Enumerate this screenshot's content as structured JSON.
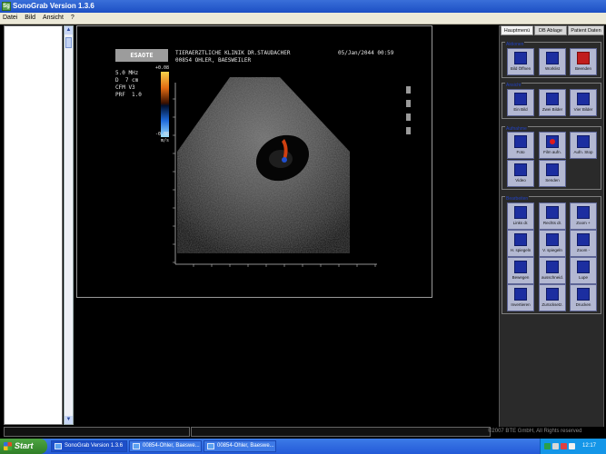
{
  "window": {
    "title": "SonoGrab Version 1.3.6",
    "app_icon": "Sg"
  },
  "menu": [
    "Datei",
    "Bild",
    "Ansicht",
    "?"
  ],
  "scrollbar": {
    "up": "▲",
    "down": "▼"
  },
  "ultrasound": {
    "brand": "ESAOTE",
    "header_line1": "TIERAERZTLICHE KLINIK DR.STAUDACHER",
    "header_line2": "00854 OHLER, BAESWEILER",
    "datetime": "05/Jan/2044 00:59",
    "params": [
      "5.0 MHz",
      "D  7 cm",
      "CFM V3",
      "PRF  1.0"
    ],
    "scale_top": "+0.08",
    "scale_bottom": "-0.08",
    "scale_unit": "m/s"
  },
  "panel": {
    "tabs": [
      "Hauptmenü",
      "DB Ablage",
      "Patient Daten"
    ],
    "groups": [
      {
        "title": "Aktionen",
        "buttons": [
          {
            "label": "Bild Öffnen",
            "icon": "folder-open-icon",
            "style": "blue"
          },
          {
            "label": "Worklist",
            "icon": "worklist-icon",
            "style": "blue"
          },
          {
            "label": "Beenden",
            "icon": "power-icon",
            "style": "red"
          }
        ]
      },
      {
        "title": "Ansicht",
        "buttons": [
          {
            "label": "Ein Bild",
            "icon": "single-view-icon",
            "style": "blue"
          },
          {
            "label": "Zwei Bilder",
            "icon": "two-view-icon",
            "style": "blue"
          },
          {
            "label": "Vier Bilder",
            "icon": "four-view-icon",
            "style": "blue"
          }
        ]
      },
      {
        "title": "Aufnahme",
        "buttons": [
          {
            "label": "Foto",
            "icon": "camera-icon",
            "style": "blue"
          },
          {
            "label": "Film aufn.",
            "icon": "record-icon",
            "style": "blue"
          },
          {
            "label": "Aufn. Stop",
            "icon": "stop-icon",
            "style": "blue"
          },
          {
            "label": "Video",
            "icon": "video-icon",
            "style": "blue"
          },
          {
            "label": "Senden",
            "icon": "send-icon",
            "style": "blue"
          }
        ]
      },
      {
        "title": "Bearbeiten",
        "buttons": [
          {
            "label": "Links dr.",
            "icon": "rotate-left-icon",
            "style": "blue"
          },
          {
            "label": "Rechts dr.",
            "icon": "rotate-right-icon",
            "style": "blue"
          },
          {
            "label": "Zoom +",
            "icon": "zoom-in-icon",
            "style": "blue"
          },
          {
            "label": "H. spiegeln",
            "icon": "flip-horizontal-icon",
            "style": "blue"
          },
          {
            "label": "V. spiegeln",
            "icon": "flip-vertical-icon",
            "style": "blue"
          },
          {
            "label": "Zoom -",
            "icon": "zoom-out-icon",
            "style": "blue"
          },
          {
            "label": "Bewegen",
            "icon": "move-icon",
            "style": "blue"
          },
          {
            "label": "ausschneid.",
            "icon": "scissors-icon",
            "style": "blue"
          },
          {
            "label": "Lupe",
            "icon": "magnifier-icon",
            "style": "blue"
          },
          {
            "label": "Invertieren",
            "icon": "invert-icon",
            "style": "blue"
          },
          {
            "label": "Zurücksetz.",
            "icon": "reset-icon",
            "style": "blue"
          },
          {
            "label": "Drucken",
            "icon": "print-icon",
            "style": "blue"
          }
        ]
      }
    ]
  },
  "statusbar": {
    "copyright": "©2007 BTE GmbH, All Rights reserved"
  },
  "taskbar": {
    "start": "Start",
    "tasks": [
      "SonoGrab Version 1.3.6",
      "00854-Ohler, Baeswe...",
      "00854-Ohler, Baeswe..."
    ],
    "clock": "12:17"
  },
  "colors": {
    "accent": "#1c2ea0",
    "panel_bg": "#2a2a2a",
    "taskbar": "#245ad8",
    "start": "#3c8f33",
    "doppler_red": "#d04010",
    "doppler_blue": "#2050d0"
  }
}
